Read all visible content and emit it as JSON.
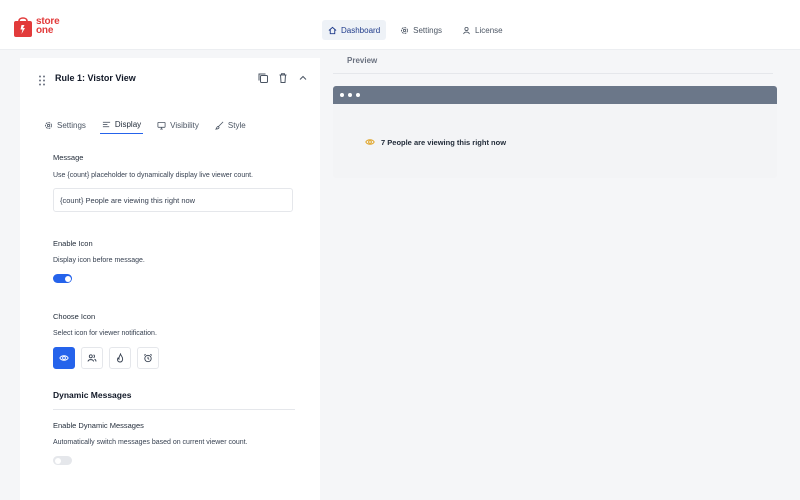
{
  "logo": {
    "line1": "store",
    "line2": "one"
  },
  "nav": {
    "dashboard": "Dashboard",
    "settings": "Settings",
    "license": "License"
  },
  "rule": {
    "title": "Rule 1: Vistor View"
  },
  "tabs": {
    "settings": "Settings",
    "display": "Display",
    "visibility": "Visibility",
    "style": "Style"
  },
  "message": {
    "label": "Message",
    "help": "Use {count} placeholder to dynamically display live viewer count.",
    "value": "{count} People are viewing this right now"
  },
  "enable_icon": {
    "label": "Enable Icon",
    "help": "Display icon before message.",
    "enabled": true
  },
  "choose_icon": {
    "label": "Choose Icon",
    "help": "Select icon for viewer notification.",
    "options": [
      "eye-icon",
      "users-icon",
      "fire-icon",
      "alarm-clock-icon"
    ],
    "selected": "eye-icon"
  },
  "dynamic": {
    "title": "Dynamic Messages",
    "label": "Enable Dynamic Messages",
    "help": "Automatically switch messages based on current viewer count.",
    "enabled": false
  },
  "preview": {
    "title": "Preview",
    "count": "7",
    "message": "People are viewing this right now"
  },
  "colors": {
    "accent": "#2563eb",
    "brand": "#e23b3b",
    "browser_bar": "#6b7789",
    "eye_icon": "#e0a62b"
  }
}
